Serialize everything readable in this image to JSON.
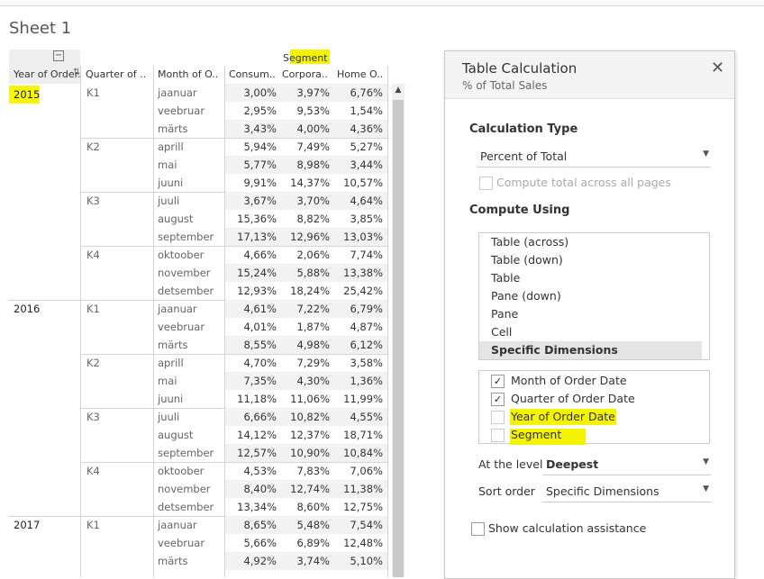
{
  "sheet": {
    "title": "Sheet 1"
  },
  "table": {
    "segment_header": "Segment",
    "columns": [
      "Year of Order..",
      "Quarter of ..",
      "Month of O..",
      "Consum..",
      "Corpora..",
      "Home O.."
    ],
    "rows": [
      {
        "year": "2015",
        "quarter": "K1",
        "month": "jaanuar",
        "v": [
          "3,00%",
          "3,97%",
          "6,76%"
        ]
      },
      {
        "year": "",
        "quarter": "",
        "month": "veebruar",
        "v": [
          "2,95%",
          "9,53%",
          "1,54%"
        ]
      },
      {
        "year": "",
        "quarter": "",
        "month": "märts",
        "v": [
          "3,43%",
          "4,00%",
          "4,36%"
        ]
      },
      {
        "year": "",
        "quarter": "K2",
        "month": "aprill",
        "v": [
          "5,94%",
          "7,49%",
          "5,27%"
        ]
      },
      {
        "year": "",
        "quarter": "",
        "month": "mai",
        "v": [
          "5,77%",
          "8,98%",
          "3,44%"
        ]
      },
      {
        "year": "",
        "quarter": "",
        "month": "juuni",
        "v": [
          "9,91%",
          "14,37%",
          "10,57%"
        ]
      },
      {
        "year": "",
        "quarter": "K3",
        "month": "juuli",
        "v": [
          "3,67%",
          "3,70%",
          "4,64%"
        ]
      },
      {
        "year": "",
        "quarter": "",
        "month": "august",
        "v": [
          "15,36%",
          "8,82%",
          "3,85%"
        ]
      },
      {
        "year": "",
        "quarter": "",
        "month": "september",
        "v": [
          "17,13%",
          "12,96%",
          "13,03%"
        ]
      },
      {
        "year": "",
        "quarter": "K4",
        "month": "oktoober",
        "v": [
          "4,66%",
          "2,06%",
          "7,74%"
        ]
      },
      {
        "year": "",
        "quarter": "",
        "month": "november",
        "v": [
          "15,24%",
          "5,88%",
          "13,38%"
        ]
      },
      {
        "year": "",
        "quarter": "",
        "month": "detsember",
        "v": [
          "12,93%",
          "18,24%",
          "25,42%"
        ]
      },
      {
        "year": "2016",
        "quarter": "K1",
        "month": "jaanuar",
        "v": [
          "4,61%",
          "7,22%",
          "6,79%"
        ]
      },
      {
        "year": "",
        "quarter": "",
        "month": "veebruar",
        "v": [
          "4,01%",
          "1,87%",
          "4,87%"
        ]
      },
      {
        "year": "",
        "quarter": "",
        "month": "märts",
        "v": [
          "8,55%",
          "4,98%",
          "6,12%"
        ]
      },
      {
        "year": "",
        "quarter": "K2",
        "month": "aprill",
        "v": [
          "4,70%",
          "7,29%",
          "3,58%"
        ]
      },
      {
        "year": "",
        "quarter": "",
        "month": "mai",
        "v": [
          "7,35%",
          "4,30%",
          "1,36%"
        ]
      },
      {
        "year": "",
        "quarter": "",
        "month": "juuni",
        "v": [
          "11,18%",
          "11,06%",
          "11,99%"
        ]
      },
      {
        "year": "",
        "quarter": "K3",
        "month": "juuli",
        "v": [
          "6,66%",
          "10,82%",
          "4,55%"
        ]
      },
      {
        "year": "",
        "quarter": "",
        "month": "august",
        "v": [
          "14,12%",
          "12,37%",
          "18,71%"
        ]
      },
      {
        "year": "",
        "quarter": "",
        "month": "september",
        "v": [
          "12,57%",
          "10,90%",
          "10,84%"
        ]
      },
      {
        "year": "",
        "quarter": "K4",
        "month": "oktoober",
        "v": [
          "4,53%",
          "7,83%",
          "7,06%"
        ]
      },
      {
        "year": "",
        "quarter": "",
        "month": "november",
        "v": [
          "8,40%",
          "12,74%",
          "11,38%"
        ]
      },
      {
        "year": "",
        "quarter": "",
        "month": "detsember",
        "v": [
          "13,34%",
          "8,60%",
          "12,75%"
        ]
      },
      {
        "year": "2017",
        "quarter": "K1",
        "month": "jaanuar",
        "v": [
          "8,65%",
          "5,48%",
          "7,54%"
        ]
      },
      {
        "year": "",
        "quarter": "",
        "month": "veebruar",
        "v": [
          "5,66%",
          "6,89%",
          "12,48%"
        ]
      },
      {
        "year": "",
        "quarter": "",
        "month": "märts",
        "v": [
          "4,92%",
          "3,74%",
          "5,10%"
        ]
      }
    ]
  },
  "dialog": {
    "title": "Table Calculation",
    "subtitle": "% of Total Sales",
    "close_icon": "close-icon",
    "calc_type_label": "Calculation Type",
    "calc_type_value": "Percent of Total",
    "compute_total_label": "Compute total across all pages",
    "compute_using_label": "Compute Using",
    "compute_using_options": [
      "Table (across)",
      "Table (down)",
      "Table",
      "Pane (down)",
      "Pane",
      "Cell",
      "Specific Dimensions"
    ],
    "dimensions": [
      {
        "label": "Month of Order Date",
        "checked": true
      },
      {
        "label": "Quarter of Order Date",
        "checked": true
      },
      {
        "label": "Year of Order Date",
        "checked": false
      },
      {
        "label": "Segment",
        "checked": false
      }
    ],
    "at_level_label": "At the level",
    "at_level_value": "Deepest",
    "sort_order_label": "Sort order",
    "sort_order_value": "Specific Dimensions",
    "show_assist_label": "Show calculation assistance",
    "highlight_color": "#f4f400"
  }
}
